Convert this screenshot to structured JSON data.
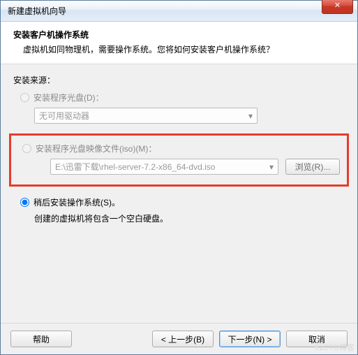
{
  "window": {
    "title": "新建虚拟机向导",
    "close_glyph": "✕"
  },
  "header": {
    "title": "安装客户机操作系统",
    "desc": "虚拟机如同物理机，需要操作系统。您将如何安装客户机操作系统？"
  },
  "source": {
    "label": "安装来源：",
    "disc": {
      "label": "安装程序光盘(D)：",
      "combo_value": "无可用驱动器"
    },
    "iso": {
      "label": "安装程序光盘映像文件(iso)(M)：",
      "path": "E:\\迅雷下载\\rhel-server-7.2-x86_64-dvd.iso",
      "browse": "浏览(R)..."
    },
    "later": {
      "label": "稍后安装操作系统(S)。",
      "desc": "创建的虚拟机将包含一个空白硬盘。"
    }
  },
  "footer": {
    "help": "帮助",
    "back": "< 上一步(B)",
    "next": "下一步(N) >",
    "cancel": "取消"
  },
  "watermark": "51CTO博客"
}
